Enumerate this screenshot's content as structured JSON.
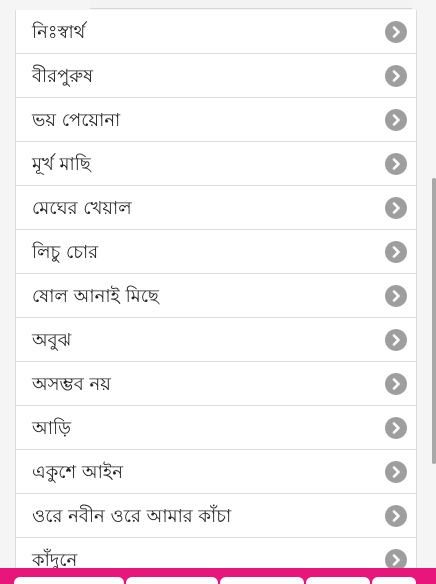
{
  "list": {
    "items": [
      {
        "label": "নিঃস্বার্থ"
      },
      {
        "label": "বীরপুরুষ"
      },
      {
        "label": "ভয় পেয়োনা"
      },
      {
        "label": "মূর্খ মাছি"
      },
      {
        "label": "মেঘের খেয়াল"
      },
      {
        "label": "লিচু চোর"
      },
      {
        "label": "ষোল আনাই মিছে"
      },
      {
        "label": "অবুঝ"
      },
      {
        "label": "অসম্ভব নয়"
      },
      {
        "label": "আড়ি"
      },
      {
        "label": "একুশে আইন"
      },
      {
        "label": "ওরে নবীন ওরে আমার কাঁচা"
      },
      {
        "label": "কাঁদুনে"
      }
    ],
    "item_icon": "chevron-right-circle-icon"
  },
  "colors": {
    "accent": "#e8157a",
    "chevron": "#9e9e9e"
  }
}
